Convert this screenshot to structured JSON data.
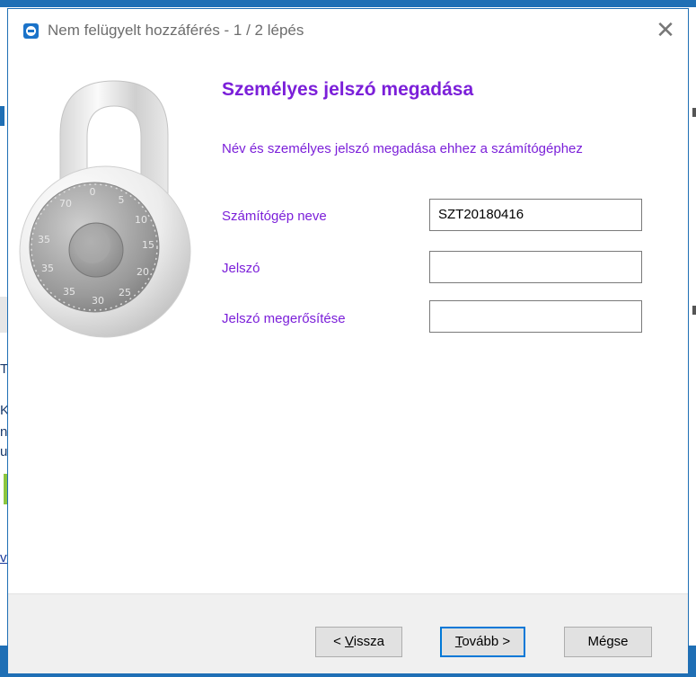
{
  "background": {
    "fragments": [
      "Te",
      "Ké",
      "nu",
      "u",
      "vv"
    ]
  },
  "dialog": {
    "title": "Nem felügyelt hozzáférés - 1 / 2 lépés",
    "close_glyph": "✕",
    "heading": "Személyes jelszó megadása",
    "description": "Név és személyes jelszó megadása ehhez a számítógéphez",
    "fields": {
      "computer_name_label": "Számítógép neve",
      "computer_name_value": "SZT20180416",
      "password_label": "Jelszó",
      "password_value": "",
      "confirm_label": "Jelszó megerősítése",
      "confirm_value": ""
    },
    "buttons": {
      "back_prefix": "< ",
      "back_mnemonic": "V",
      "back_rest": "issza",
      "next_mnemonic": "T",
      "next_rest": "ovább >",
      "cancel": "Mégse"
    }
  },
  "colors": {
    "accent_purple": "#7b1fd9",
    "window_blue": "#1f6fb5",
    "focus_blue": "#0078d7"
  }
}
